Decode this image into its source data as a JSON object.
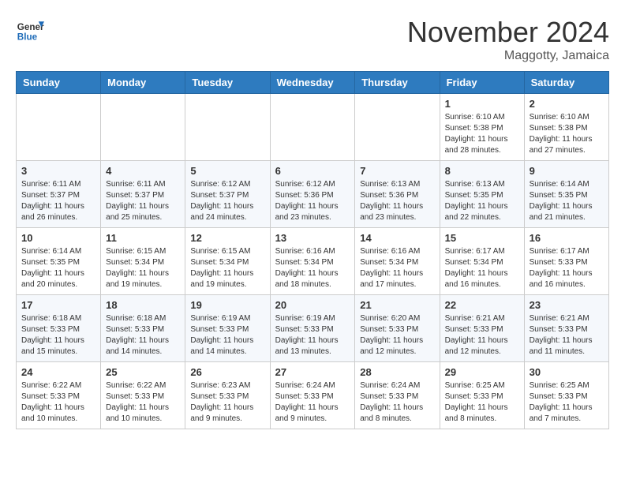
{
  "header": {
    "logo_line1": "General",
    "logo_line2": "Blue",
    "month": "November 2024",
    "location": "Maggotty, Jamaica"
  },
  "weekdays": [
    "Sunday",
    "Monday",
    "Tuesday",
    "Wednesday",
    "Thursday",
    "Friday",
    "Saturday"
  ],
  "weeks": [
    [
      {
        "day": "",
        "info": ""
      },
      {
        "day": "",
        "info": ""
      },
      {
        "day": "",
        "info": ""
      },
      {
        "day": "",
        "info": ""
      },
      {
        "day": "",
        "info": ""
      },
      {
        "day": "1",
        "info": "Sunrise: 6:10 AM\nSunset: 5:38 PM\nDaylight: 11 hours\nand 28 minutes."
      },
      {
        "day": "2",
        "info": "Sunrise: 6:10 AM\nSunset: 5:38 PM\nDaylight: 11 hours\nand 27 minutes."
      }
    ],
    [
      {
        "day": "3",
        "info": "Sunrise: 6:11 AM\nSunset: 5:37 PM\nDaylight: 11 hours\nand 26 minutes."
      },
      {
        "day": "4",
        "info": "Sunrise: 6:11 AM\nSunset: 5:37 PM\nDaylight: 11 hours\nand 25 minutes."
      },
      {
        "day": "5",
        "info": "Sunrise: 6:12 AM\nSunset: 5:37 PM\nDaylight: 11 hours\nand 24 minutes."
      },
      {
        "day": "6",
        "info": "Sunrise: 6:12 AM\nSunset: 5:36 PM\nDaylight: 11 hours\nand 23 minutes."
      },
      {
        "day": "7",
        "info": "Sunrise: 6:13 AM\nSunset: 5:36 PM\nDaylight: 11 hours\nand 23 minutes."
      },
      {
        "day": "8",
        "info": "Sunrise: 6:13 AM\nSunset: 5:35 PM\nDaylight: 11 hours\nand 22 minutes."
      },
      {
        "day": "9",
        "info": "Sunrise: 6:14 AM\nSunset: 5:35 PM\nDaylight: 11 hours\nand 21 minutes."
      }
    ],
    [
      {
        "day": "10",
        "info": "Sunrise: 6:14 AM\nSunset: 5:35 PM\nDaylight: 11 hours\nand 20 minutes."
      },
      {
        "day": "11",
        "info": "Sunrise: 6:15 AM\nSunset: 5:34 PM\nDaylight: 11 hours\nand 19 minutes."
      },
      {
        "day": "12",
        "info": "Sunrise: 6:15 AM\nSunset: 5:34 PM\nDaylight: 11 hours\nand 19 minutes."
      },
      {
        "day": "13",
        "info": "Sunrise: 6:16 AM\nSunset: 5:34 PM\nDaylight: 11 hours\nand 18 minutes."
      },
      {
        "day": "14",
        "info": "Sunrise: 6:16 AM\nSunset: 5:34 PM\nDaylight: 11 hours\nand 17 minutes."
      },
      {
        "day": "15",
        "info": "Sunrise: 6:17 AM\nSunset: 5:34 PM\nDaylight: 11 hours\nand 16 minutes."
      },
      {
        "day": "16",
        "info": "Sunrise: 6:17 AM\nSunset: 5:33 PM\nDaylight: 11 hours\nand 16 minutes."
      }
    ],
    [
      {
        "day": "17",
        "info": "Sunrise: 6:18 AM\nSunset: 5:33 PM\nDaylight: 11 hours\nand 15 minutes."
      },
      {
        "day": "18",
        "info": "Sunrise: 6:18 AM\nSunset: 5:33 PM\nDaylight: 11 hours\nand 14 minutes."
      },
      {
        "day": "19",
        "info": "Sunrise: 6:19 AM\nSunset: 5:33 PM\nDaylight: 11 hours\nand 14 minutes."
      },
      {
        "day": "20",
        "info": "Sunrise: 6:19 AM\nSunset: 5:33 PM\nDaylight: 11 hours\nand 13 minutes."
      },
      {
        "day": "21",
        "info": "Sunrise: 6:20 AM\nSunset: 5:33 PM\nDaylight: 11 hours\nand 12 minutes."
      },
      {
        "day": "22",
        "info": "Sunrise: 6:21 AM\nSunset: 5:33 PM\nDaylight: 11 hours\nand 12 minutes."
      },
      {
        "day": "23",
        "info": "Sunrise: 6:21 AM\nSunset: 5:33 PM\nDaylight: 11 hours\nand 11 minutes."
      }
    ],
    [
      {
        "day": "24",
        "info": "Sunrise: 6:22 AM\nSunset: 5:33 PM\nDaylight: 11 hours\nand 10 minutes."
      },
      {
        "day": "25",
        "info": "Sunrise: 6:22 AM\nSunset: 5:33 PM\nDaylight: 11 hours\nand 10 minutes."
      },
      {
        "day": "26",
        "info": "Sunrise: 6:23 AM\nSunset: 5:33 PM\nDaylight: 11 hours\nand 9 minutes."
      },
      {
        "day": "27",
        "info": "Sunrise: 6:24 AM\nSunset: 5:33 PM\nDaylight: 11 hours\nand 9 minutes."
      },
      {
        "day": "28",
        "info": "Sunrise: 6:24 AM\nSunset: 5:33 PM\nDaylight: 11 hours\nand 8 minutes."
      },
      {
        "day": "29",
        "info": "Sunrise: 6:25 AM\nSunset: 5:33 PM\nDaylight: 11 hours\nand 8 minutes."
      },
      {
        "day": "30",
        "info": "Sunrise: 6:25 AM\nSunset: 5:33 PM\nDaylight: 11 hours\nand 7 minutes."
      }
    ]
  ]
}
